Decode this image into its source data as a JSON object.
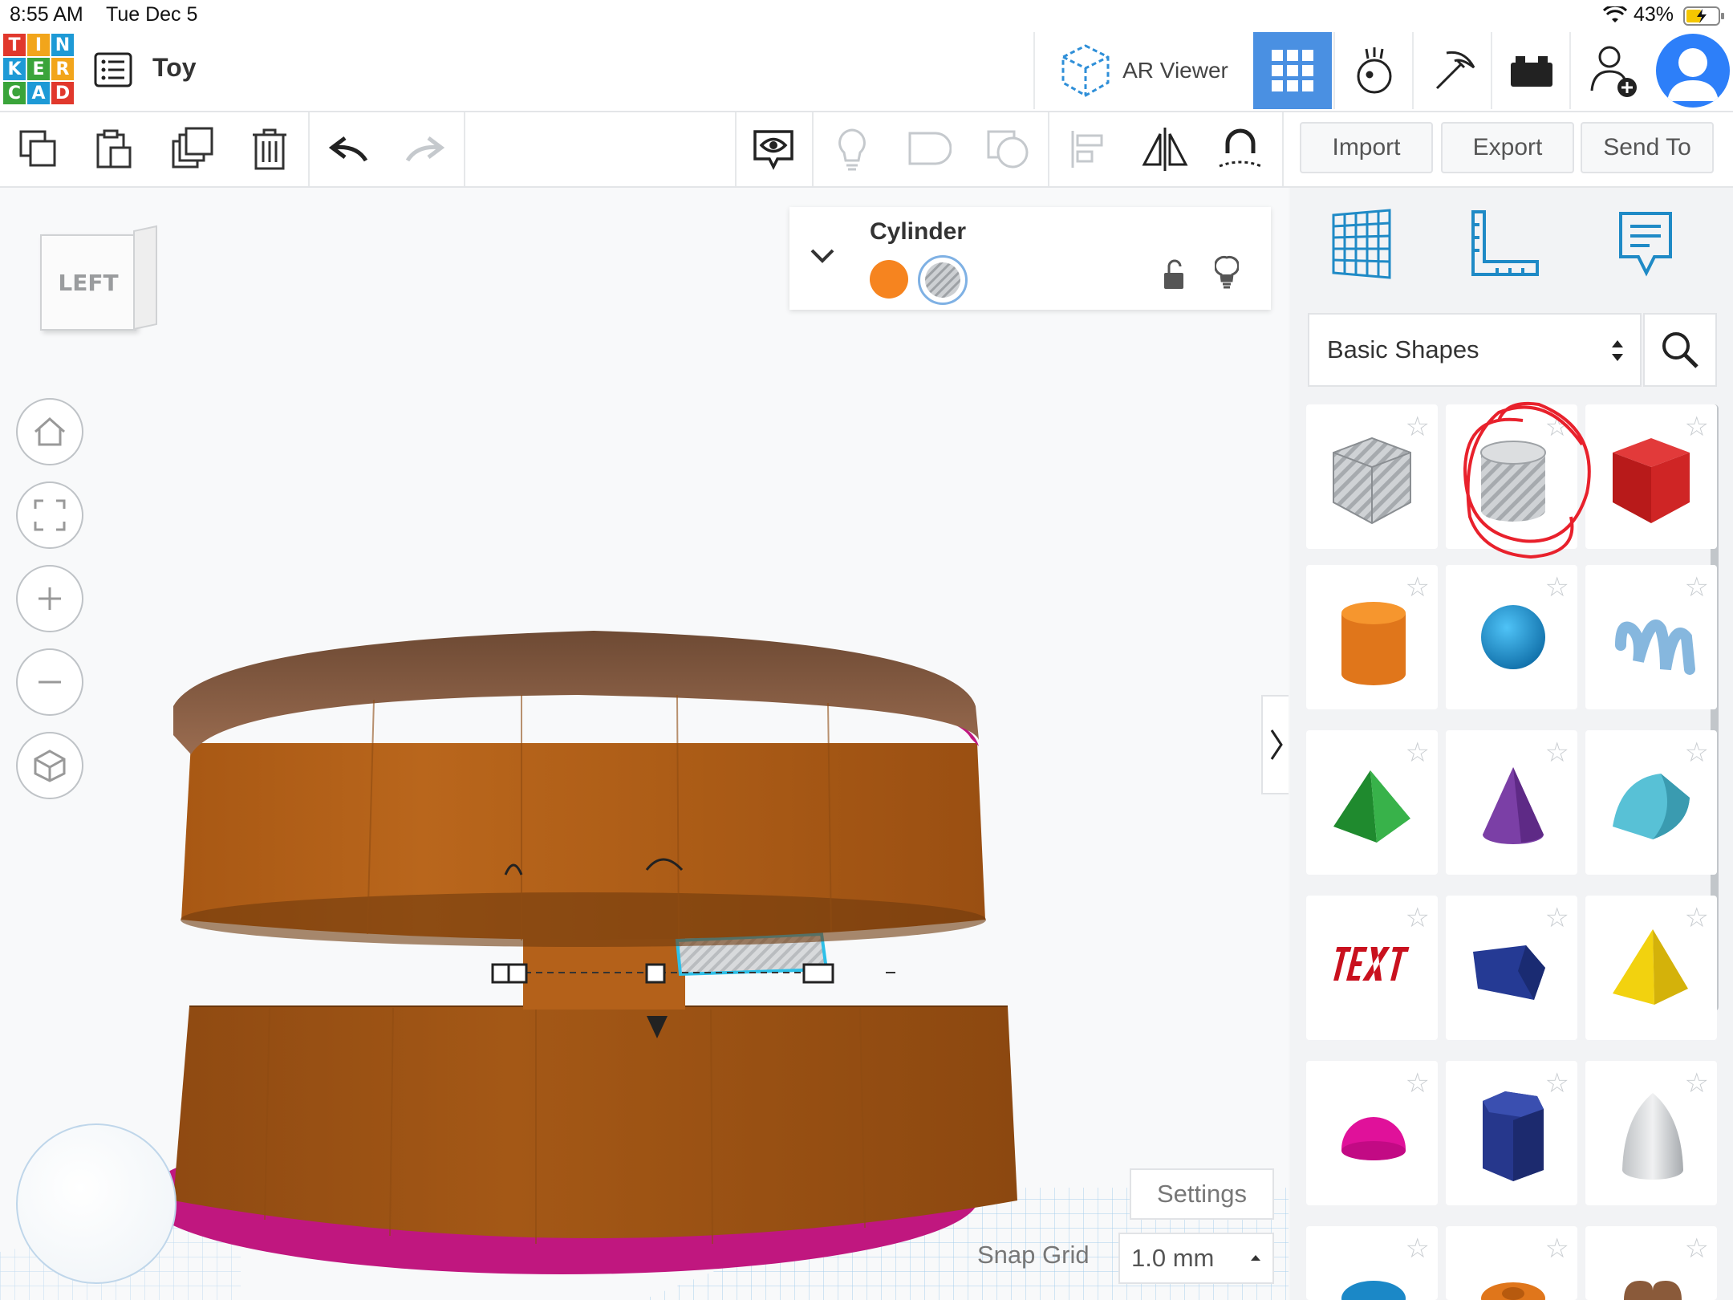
{
  "status": {
    "time": "8:55 AM",
    "date": "Tue Dec 5",
    "battery": "43%"
  },
  "app": {
    "logo_letters": [
      "T",
      "I",
      "N",
      "K",
      "E",
      "R",
      "C",
      "A",
      "D"
    ],
    "logo_colors": [
      "#e1382c",
      "#f2a51b",
      "#1e9ad6",
      "#1e9ad6",
      "#e1382c",
      "#f2a51b",
      "#f2a51b",
      "#1e9ad6",
      "#e1382c"
    ],
    "project_name": "Toy"
  },
  "topbar": {
    "ar_label": "AR Viewer"
  },
  "toolbar": {
    "import": "Import",
    "export": "Export",
    "send_to": "Send To"
  },
  "inspector": {
    "shape_name": "Cylinder",
    "solid_color": "#f6841f"
  },
  "viewcube": {
    "label": "LEFT"
  },
  "library": {
    "category": "Basic Shapes"
  },
  "shapes": [
    {
      "name": "box-hole-shape"
    },
    {
      "name": "cylinder-hole-shape"
    },
    {
      "name": "box-shape"
    },
    {
      "name": "cylinder-shape"
    },
    {
      "name": "sphere-shape"
    },
    {
      "name": "scribble-shape"
    },
    {
      "name": "roof-shape"
    },
    {
      "name": "cone-shape"
    },
    {
      "name": "round-roof-shape"
    },
    {
      "name": "text-shape"
    },
    {
      "name": "polygon-shape"
    },
    {
      "name": "pyramid-shape"
    },
    {
      "name": "half-sphere-shape"
    },
    {
      "name": "hexagonal-prism-shape"
    },
    {
      "name": "paraboloid-shape"
    },
    {
      "name": "torus-shape"
    },
    {
      "name": "tube-shape"
    },
    {
      "name": "heart-shape"
    }
  ],
  "workplane": {
    "settings": "Settings",
    "snap_label": "Snap Grid",
    "snap_value": "1.0 mm"
  }
}
